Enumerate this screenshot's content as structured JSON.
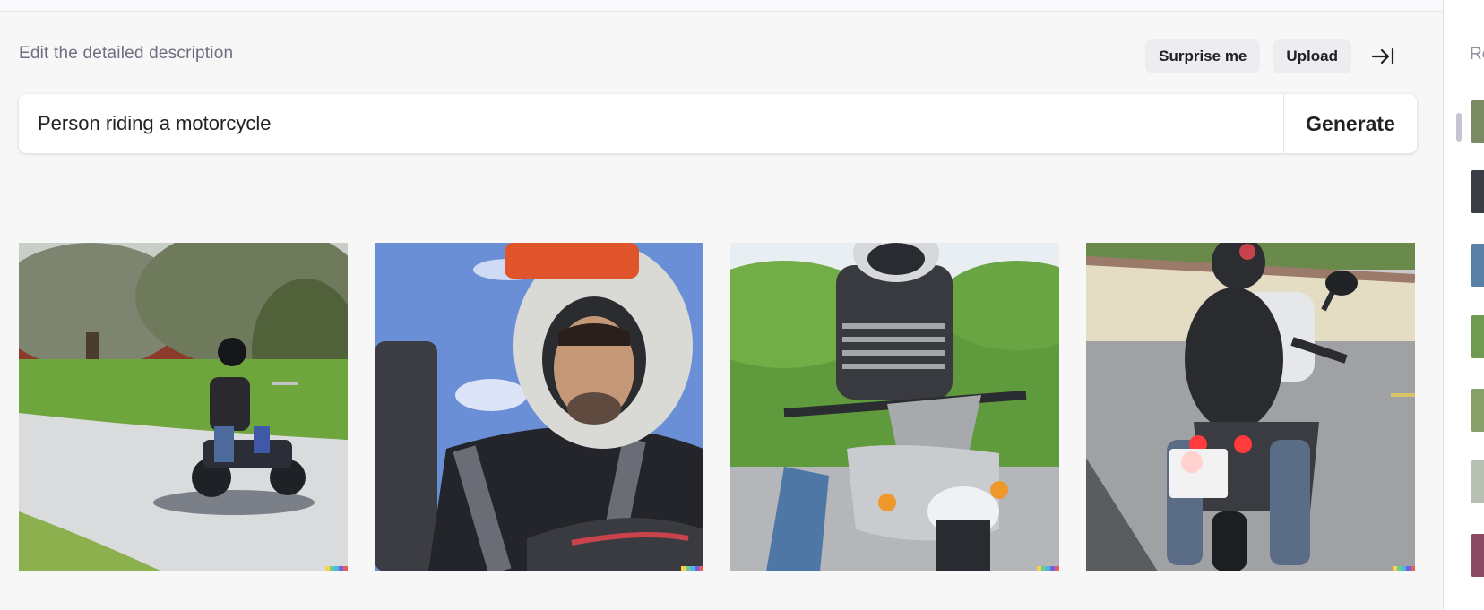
{
  "prompt_section": {
    "label": "Edit the detailed description",
    "surprise_label": "Surprise me",
    "upload_label": "Upload",
    "input_value": "Person riding a motorcycle",
    "generate_label": "Generate"
  },
  "results": [
    {
      "name": "Rider on cruiser motorcycle on park road"
    },
    {
      "name": "Close-up of rider in helmet against blue sky"
    },
    {
      "name": "Rider in jacket on sport motorcycle, front view"
    },
    {
      "name": "Rider from behind with backpack on street"
    }
  ],
  "sidebar": {
    "title": "Recent"
  },
  "colors": {
    "background": "#f7f7f8",
    "chip": "#ececf1",
    "text": "#202123",
    "muted": "#6e6e80"
  },
  "signature_colors": [
    "#f8d249",
    "#67cd97",
    "#52b5e0",
    "#6e62e6",
    "#e65d5d"
  ]
}
